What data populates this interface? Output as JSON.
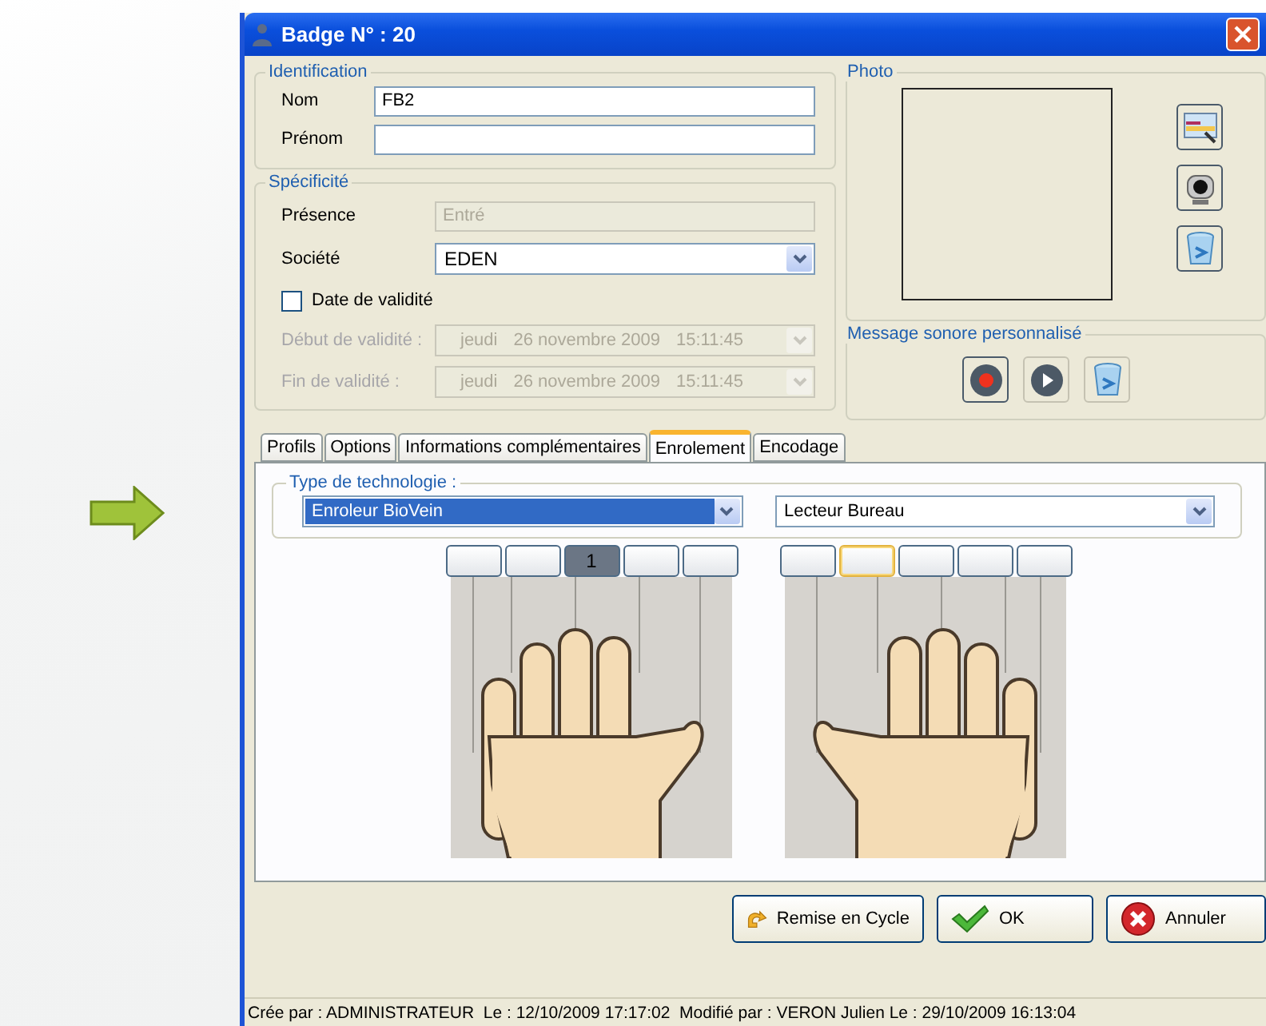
{
  "window": {
    "title": "Badge N° : 20"
  },
  "identification": {
    "title": "Identification",
    "fields": [
      {
        "label": "Nom",
        "value": "FB2"
      },
      {
        "label": "Prénom"
      }
    ]
  },
  "specificite": {
    "title": "Spécificité",
    "presence": {
      "label": "Présence",
      "value": "Entré",
      "disabled": true
    },
    "societe": {
      "label": "Société",
      "value": "EDEN"
    },
    "date_validite": {
      "label": "Date de validité",
      "checked": false
    },
    "dates": [
      {
        "label": "Début de validité :",
        "day": "jeudi",
        "date": "26 novembre 2009",
        "time": "15:11:45",
        "disabled": true
      },
      {
        "label": "Fin de validité :",
        "day": "jeudi",
        "date": "26 novembre 2009",
        "time": "15:11:45",
        "disabled": true
      }
    ]
  },
  "photo": {
    "title": "Photo"
  },
  "message": {
    "title": "Message sonore personnalisé"
  },
  "tabs": [
    {
      "label": "Profils",
      "selected": false
    },
    {
      "label": "Options",
      "selected": false
    },
    {
      "label": "Informations complémentaires",
      "selected": false
    },
    {
      "label": "Enrolement",
      "selected": true
    },
    {
      "label": "Encodage",
      "selected": false
    }
  ],
  "technology": {
    "title": "Type de technologie :",
    "selects": [
      {
        "value": "Enroleur BioVein",
        "highlighted": true
      },
      {
        "value": "Lecteur Bureau",
        "highlighted": false
      }
    ]
  },
  "hands": [
    {
      "fingers": [
        {
          "selected": false,
          "focused": false
        },
        {
          "selected": false,
          "focused": false
        },
        {
          "selected": true,
          "focused": false,
          "label": "1"
        },
        {
          "selected": false,
          "focused": false
        },
        {
          "selected": false,
          "focused": false
        }
      ]
    },
    {
      "fingers": [
        {
          "selected": false,
          "focused": false
        },
        {
          "selected": false,
          "focused": true
        },
        {
          "selected": false,
          "focused": false
        },
        {
          "selected": false,
          "focused": false
        },
        {
          "selected": false,
          "focused": false
        }
      ]
    }
  ],
  "buttons": [
    {
      "kind": "cycle",
      "label": "Remise en Cycle"
    },
    {
      "kind": "ok",
      "label": "OK"
    },
    {
      "kind": "cancel",
      "label": "Annuler"
    }
  ],
  "status_bar": "Crée par : ADMINISTRATEUR  Le : 12/10/2009 17:17:02  Modifié par : VERON Julien Le : 29/10/2009 16:13:04"
}
